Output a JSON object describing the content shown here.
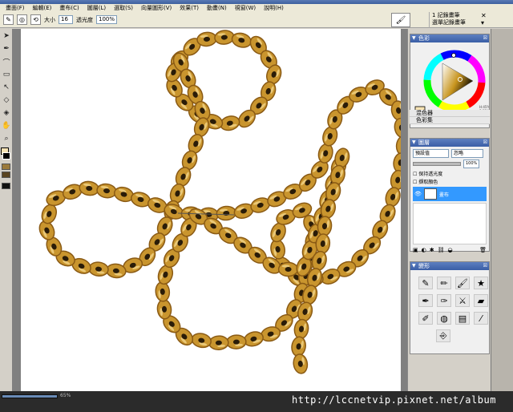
{
  "menu": [
    "畫面(F)",
    "編輯(E)",
    "畫布(C)",
    "圖層(L)",
    "選取(S)",
    "向量圖形(V)",
    "效果(T)",
    "動畫(N)",
    "視窗(W)",
    "說明(H)"
  ],
  "options_bar": {
    "size_label": "大小",
    "size_value": "16",
    "opacity_label": "透光度",
    "opacity_value": "100%"
  },
  "document": {
    "line1": "1 記錄畫筆",
    "line2": "選單記錄畫筆"
  },
  "panels": {
    "color": {
      "title": "色彩"
    },
    "mixer": {
      "label": "混色器"
    },
    "swatches": {
      "label": "色彩集"
    },
    "layers": {
      "title": "圖層",
      "composite_method": "預設值",
      "composite_label": "忽略",
      "opacity_value": "100%",
      "preserve_transparency": "保持透光度",
      "pick_up_underlying": "擷取顏色",
      "layer_name": "畫布"
    },
    "tools": {
      "title": "變形",
      "tool_icons": [
        "marker-icon",
        "pencil-icon",
        "brush-icon",
        "star-brush-icon",
        "color-pen-icon",
        "pen-icon",
        "knife-icon",
        "eraser-icon",
        "color-brush-icon",
        "blend-icon",
        "fill-icon",
        "smear-icon"
      ],
      "extra_icon": "stamp-icon"
    }
  },
  "status": {
    "zoom": "65%"
  },
  "watermark": "http://lccnetvip.pixnet.net/album",
  "colors": {
    "accent": "#3a5ea6",
    "layer_selected": "#3399ff",
    "chain_gold": "#c9952e",
    "chain_dark": "#8a5a14"
  }
}
